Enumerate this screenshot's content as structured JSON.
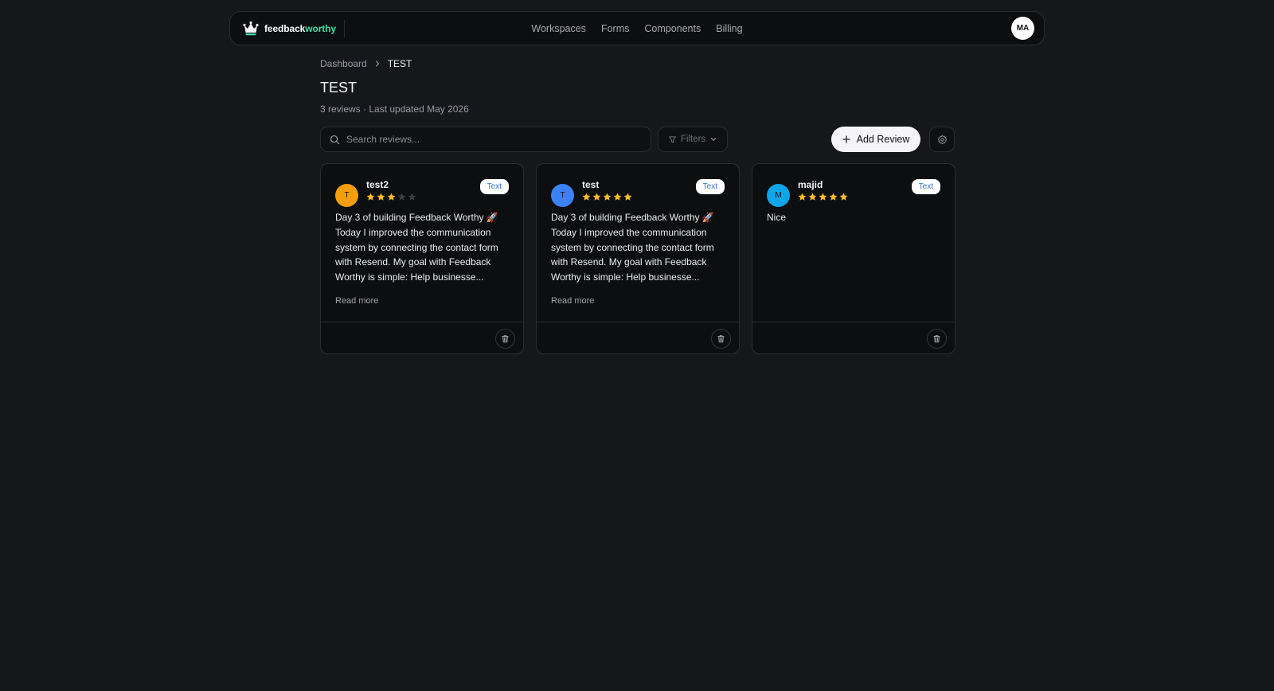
{
  "brand": {
    "name_part1": "feedback",
    "name_part2": "worthy",
    "accent": "#3fe0a8"
  },
  "nav": {
    "links": [
      "Workspaces",
      "Forms",
      "Components",
      "Billing"
    ],
    "avatar_initials": "MA"
  },
  "breadcrumb": {
    "parent": "Dashboard",
    "current": "TEST"
  },
  "page": {
    "title": "TEST",
    "subtitle": "3 reviews · Last updated May 2026"
  },
  "toolbar": {
    "search_placeholder": "Search reviews...",
    "filters_label": "Filters",
    "add_review_label": "Add Review"
  },
  "reviews": [
    {
      "initial": "T",
      "name": "test2",
      "rating": 3,
      "max_rating": 5,
      "avatar_color": "#f59e0b",
      "badge": "Text",
      "text": "Day 3 of building Feedback Worthy 🚀 Today I improved the communication system by connecting the contact form with Resend. My goal with Feedback Worthy is simple: Help businesse...",
      "read_more": "Read more"
    },
    {
      "initial": "T",
      "name": "test",
      "rating": 5,
      "max_rating": 5,
      "avatar_color": "#3b82f6",
      "badge": "Text",
      "text": "Day 3 of building Feedback Worthy 🚀 Today I improved the communication system by connecting the contact form with Resend. My goal with Feedback Worthy is simple: Help businesse...",
      "read_more": "Read more"
    },
    {
      "initial": "M",
      "name": "majid",
      "rating": 5,
      "max_rating": 5,
      "avatar_color": "#0ea5e9",
      "badge": "Text",
      "text": "Nice",
      "read_more": ""
    }
  ],
  "colors": {
    "star_filled": "#fbbf24",
    "star_empty": "#3a3b40",
    "background": "#16171b"
  }
}
